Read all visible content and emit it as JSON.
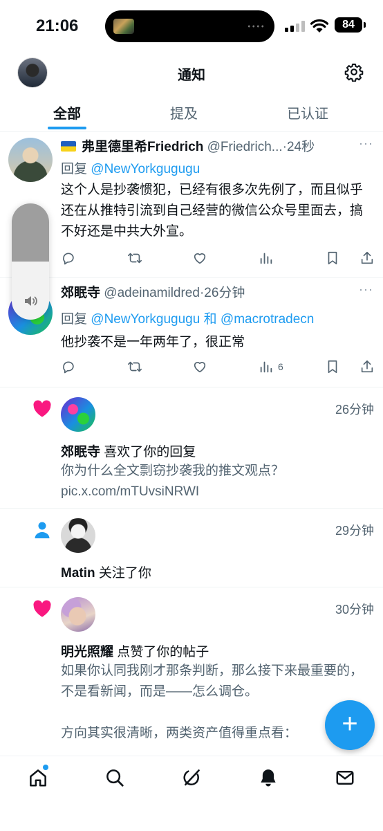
{
  "status_bar": {
    "time": "21:06",
    "battery": "84"
  },
  "header": {
    "title": "通知"
  },
  "tabs": [
    {
      "label": "全部",
      "active": true
    },
    {
      "label": "提及",
      "active": false
    },
    {
      "label": "已认证",
      "active": false
    }
  ],
  "posts": [
    {
      "author": "弗里德里希Friedrich",
      "handle": "@Friedrich...",
      "time": "·24秒",
      "reply_prefix": "回复",
      "reply_to": "@NewYorkgugugu",
      "text": "这个人是抄袭惯犯，已经有很多次先例了，而且似乎还在从推特引流到自己经营的微信公众号里面去，搞不好还是中共大外宣。",
      "views": ""
    },
    {
      "author": "郊眠寺",
      "handle": "@adeinamildred",
      "time": "·26分钟",
      "reply_prefix": "回复",
      "reply_to": "@NewYorkgugugu",
      "reply_and": "和",
      "reply_to_2": "@macrotradecn",
      "text": "他抄袭不是一年两年了，很正常",
      "views": "6"
    }
  ],
  "notifications": [
    {
      "type": "like",
      "icon": "heart-icon",
      "time": "26分钟",
      "user": "郊眠寺",
      "action": "喜欢了你的回复",
      "text": "你为什么全文剽窃抄袭我的推文观点？\npic.x.com/mTUvsiNRWI"
    },
    {
      "type": "follow",
      "icon": "person-icon",
      "time": "29分钟",
      "user": "Matin",
      "action": "关注了你"
    },
    {
      "type": "like",
      "icon": "heart-icon",
      "time": "30分钟",
      "user": "明光照耀",
      "action": "点赞了你的帖子",
      "text": "如果你认同我刚才那条判断，那么接下来最重要的，不是看新闻，而是——怎么调仓。\n\n方向其实很清晰，两类资产值得重点看："
    }
  ],
  "fab": {
    "label": "+"
  },
  "colors": {
    "accent": "#1d9bf0",
    "heart": "#f91880",
    "text": "#0f1419",
    "muted": "#536471"
  },
  "volume_level": 0.5
}
